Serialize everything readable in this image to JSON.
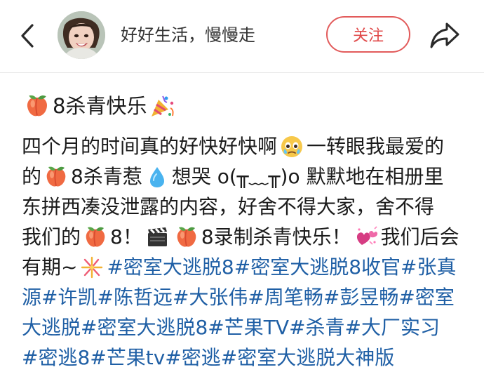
{
  "header": {
    "username": "好好生活，慢慢走",
    "follow_label": "关注"
  },
  "post": {
    "title_text": "8杀青快乐",
    "lines": [
      {
        "segments": [
          {
            "type": "text",
            "text": "四个月的时间真的好快好快啊"
          },
          {
            "type": "emoji",
            "icon": "teary-face-icon"
          },
          {
            "type": "text",
            "text": "一转眼我最爱的"
          }
        ]
      },
      {
        "segments": [
          {
            "type": "text",
            "text": "的"
          },
          {
            "type": "emoji",
            "icon": "peach-icon"
          },
          {
            "type": "text",
            "text": "8杀青惹"
          },
          {
            "type": "emoji",
            "icon": "droplet-icon"
          },
          {
            "type": "text",
            "text": " 想哭 o(╥﹏╥)o 默默地在相册里"
          }
        ]
      },
      {
        "segments": [
          {
            "type": "text",
            "text": "东拼西凑没泄露的内容，好舍不得大家，舍不得"
          }
        ]
      },
      {
        "segments": [
          {
            "type": "text",
            "text": "我们的"
          },
          {
            "type": "emoji",
            "icon": "peach-icon"
          },
          {
            "type": "text",
            "text": "8！"
          },
          {
            "type": "emoji",
            "icon": "clapperboard-icon"
          },
          {
            "type": "emoji",
            "icon": "peach-icon"
          },
          {
            "type": "text",
            "text": "8录制杀青快乐！"
          },
          {
            "type": "emoji",
            "icon": "hearts-icon"
          },
          {
            "type": "text",
            "text": "我们后会"
          }
        ]
      },
      {
        "segments": [
          {
            "type": "text",
            "text": "有期~"
          },
          {
            "type": "emoji",
            "icon": "firework-icon"
          },
          {
            "type": "tag",
            "text": "#密室大逃脱8"
          },
          {
            "type": "text",
            "text": " "
          },
          {
            "type": "tag",
            "text": "#密室大逃脱8收官"
          },
          {
            "type": "text",
            "text": " "
          },
          {
            "type": "tag",
            "text": "#张真"
          }
        ]
      },
      {
        "segments": [
          {
            "type": "tag",
            "text": "源"
          },
          {
            "type": "text",
            "text": " "
          },
          {
            "type": "tag",
            "text": "#许凯"
          },
          {
            "type": "text",
            "text": " "
          },
          {
            "type": "tag",
            "text": "#陈哲远"
          },
          {
            "type": "text",
            "text": " "
          },
          {
            "type": "tag",
            "text": "#大张伟"
          },
          {
            "type": "text",
            "text": " "
          },
          {
            "type": "tag",
            "text": "#周笔畅"
          },
          {
            "type": "text",
            "text": " "
          },
          {
            "type": "tag",
            "text": "#彭昱畅"
          },
          {
            "type": "text",
            "text": " "
          },
          {
            "type": "tag",
            "text": "#密室"
          }
        ]
      },
      {
        "segments": [
          {
            "type": "tag",
            "text": "大逃脱"
          },
          {
            "type": "text",
            "text": " "
          },
          {
            "type": "tag",
            "text": "#密室大逃脱8"
          },
          {
            "type": "text",
            "text": " "
          },
          {
            "type": "tag",
            "text": "#芒果TV"
          },
          {
            "type": "text",
            "text": " "
          },
          {
            "type": "tag",
            "text": "#杀青"
          },
          {
            "type": "text",
            "text": " "
          },
          {
            "type": "tag",
            "text": "#大厂实习"
          }
        ]
      },
      {
        "segments": [
          {
            "type": "tag",
            "text": "#密逃8"
          },
          {
            "type": "text",
            "text": " "
          },
          {
            "type": "tag",
            "text": "#芒果tv"
          },
          {
            "type": "text",
            "text": " "
          },
          {
            "type": "tag",
            "text": "#密逃"
          },
          {
            "type": "text",
            "text": " "
          },
          {
            "type": "tag",
            "text": "#密室大逃脱大神版"
          }
        ]
      }
    ]
  },
  "colors": {
    "follow_red": "#e04a4a",
    "hashtag_blue": "#1f5fa5",
    "text_dark": "#1b1b1b"
  }
}
